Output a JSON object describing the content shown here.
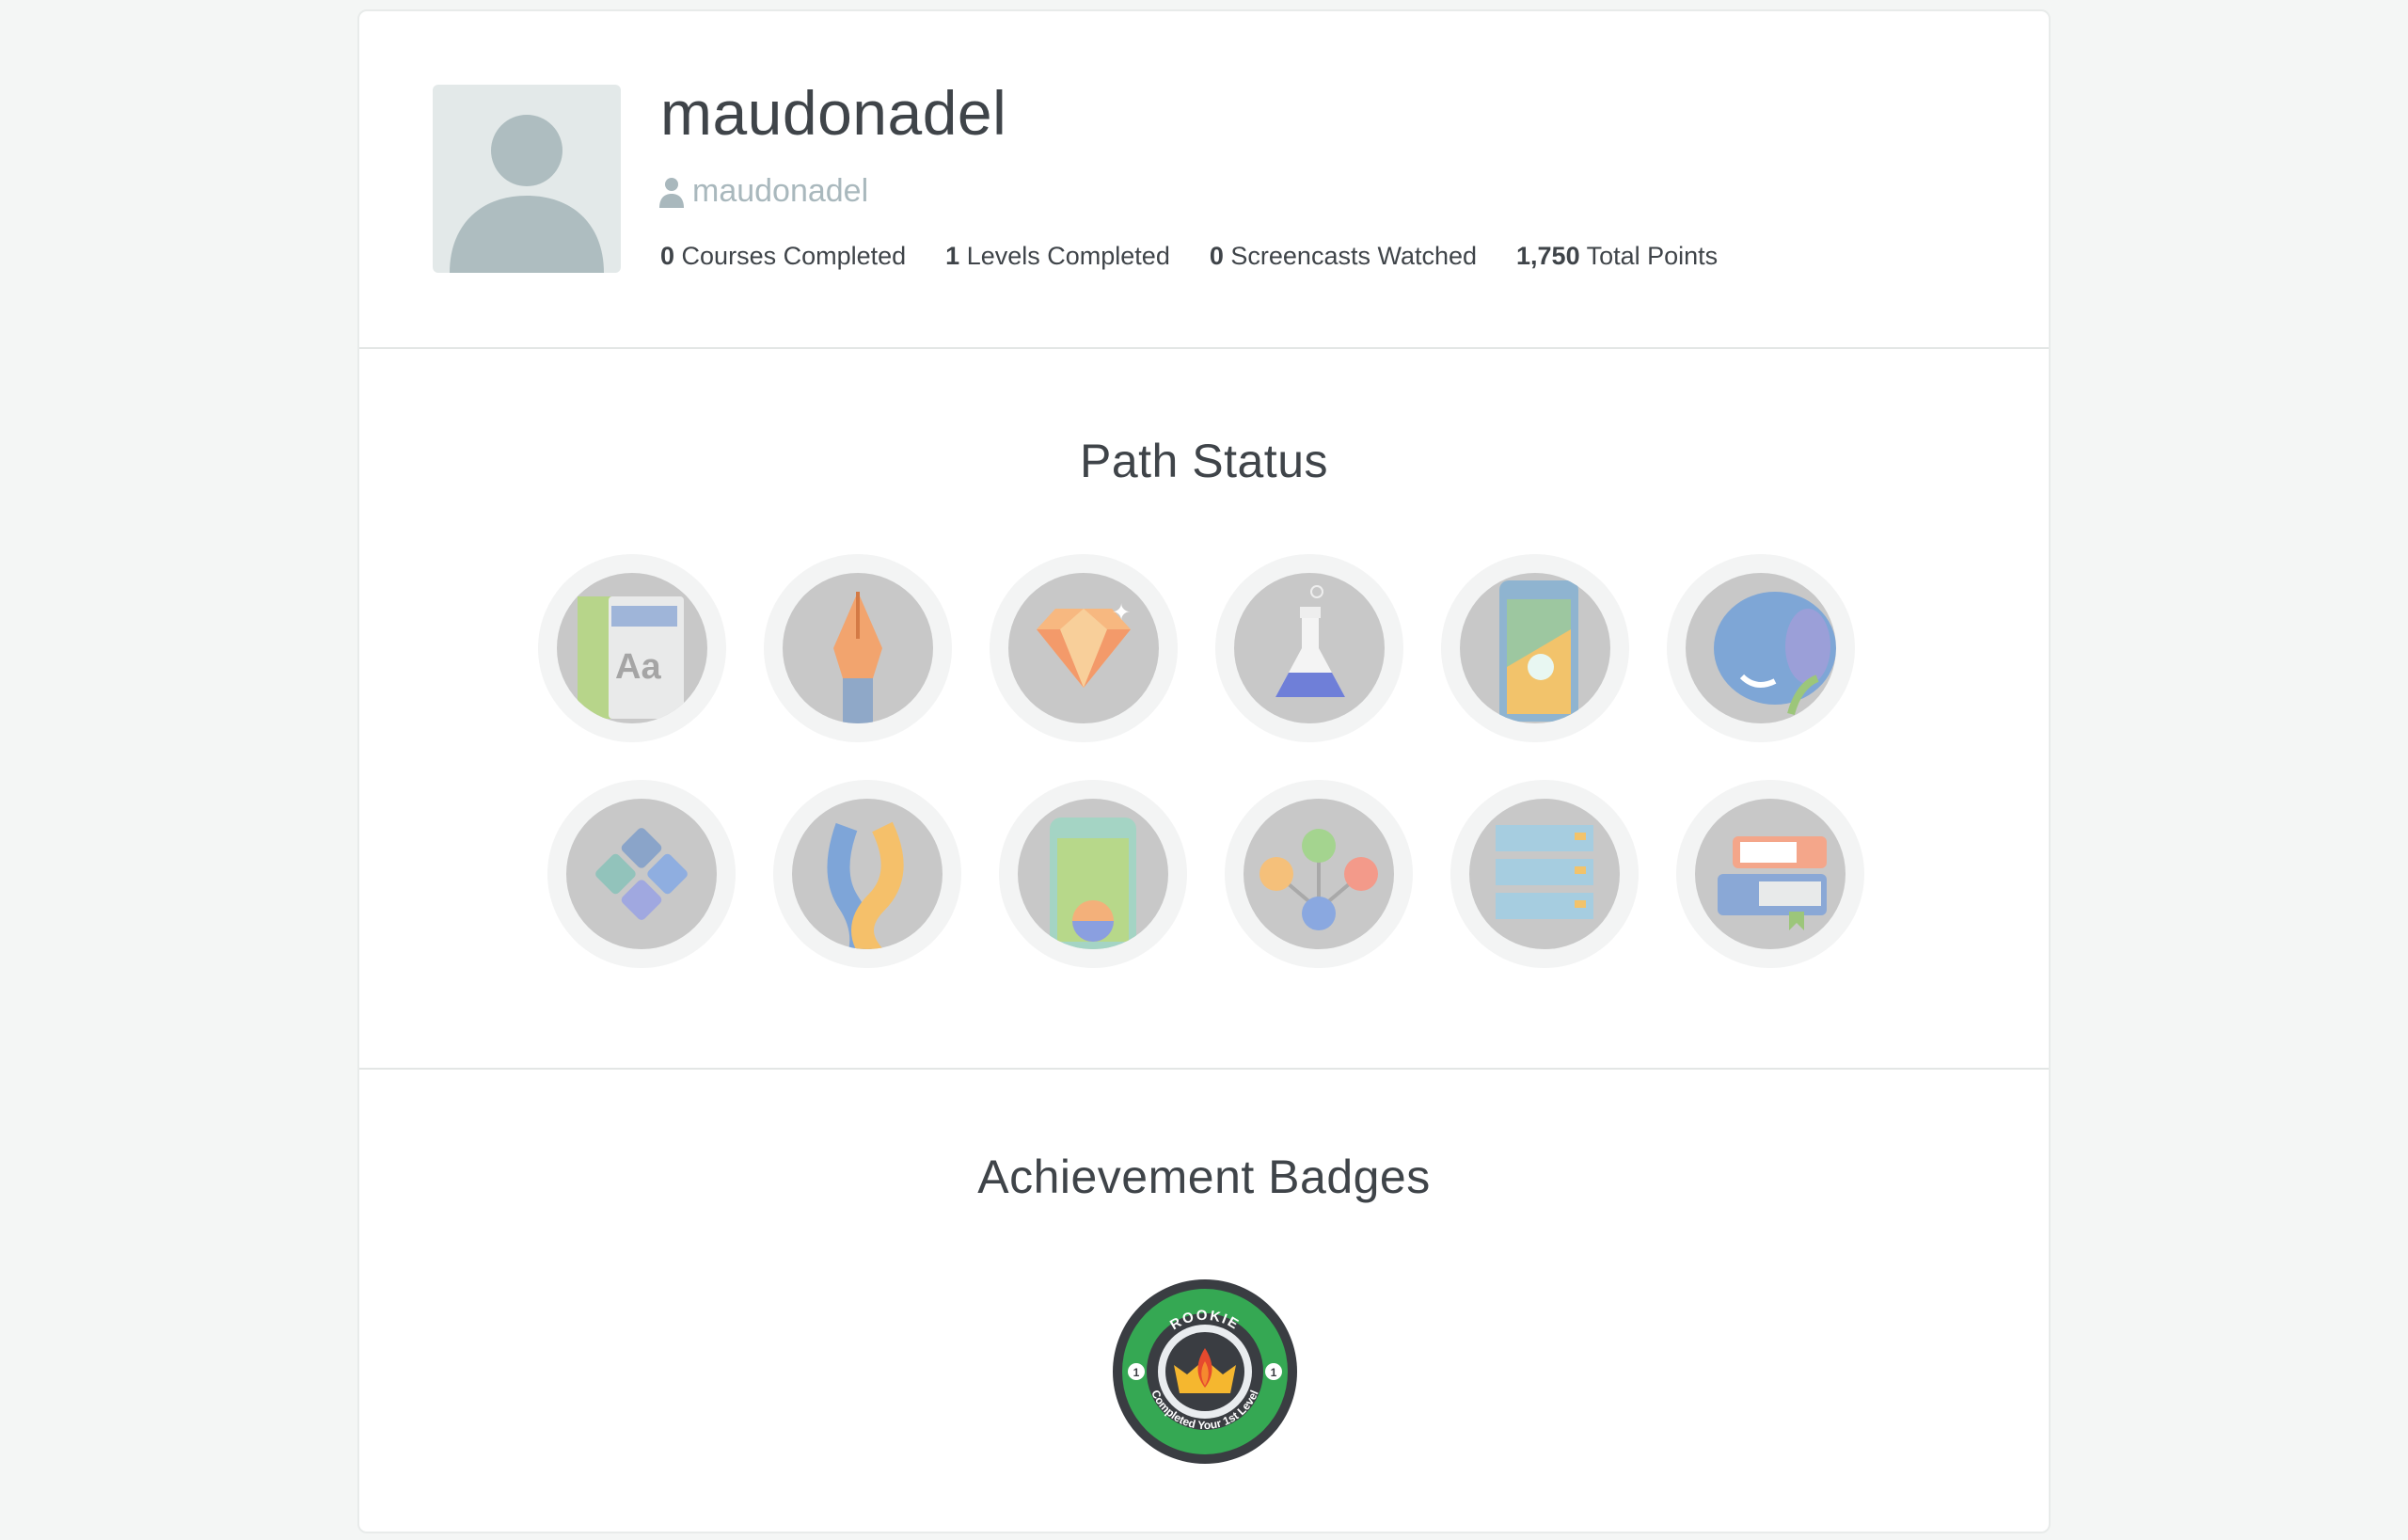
{
  "profile": {
    "name": "maudonadel",
    "handle": "maudonadel",
    "stats": [
      {
        "value": "0",
        "label": "Courses Completed"
      },
      {
        "value": "1",
        "label": "Levels Completed"
      },
      {
        "value": "0",
        "label": "Screencasts Watched"
      },
      {
        "value": "1,750",
        "label": "Total Points"
      }
    ]
  },
  "path_status": {
    "title": "Path Status",
    "badges_row1": [
      "typography-icon",
      "pen-nib-icon",
      "ruby-gem-icon",
      "flask-icon",
      "mobile-touch-icon",
      "elephant-icon"
    ],
    "badges_row2": [
      "grid-diamond-icon",
      "snakes-icon",
      "phone-gradient-icon",
      "network-nodes-icon",
      "server-rack-icon",
      "books-icon"
    ]
  },
  "achievements": {
    "title": "Achievement Badges",
    "rookie": {
      "top_text": "ROOKIE",
      "bottom_text": "Completed Your 1st Level",
      "number": "1",
      "colors": {
        "ring": "#35a853",
        "dark": "#3a3d42"
      }
    }
  }
}
